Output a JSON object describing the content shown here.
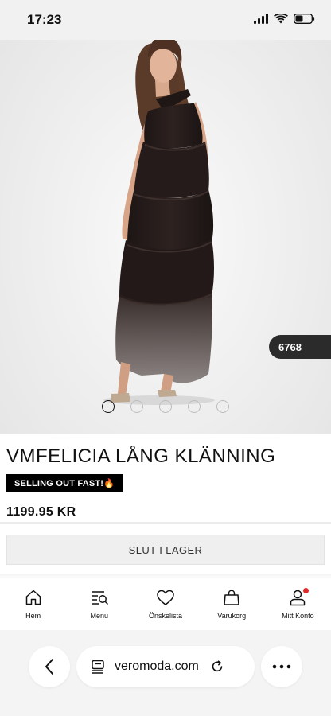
{
  "status_bar": {
    "time": "17:23"
  },
  "hero": {
    "image_counter": "6768",
    "carousel_pages": 5,
    "carousel_active_index": 0
  },
  "product": {
    "title": "VMFELICIA LÅNG KLÄNNING",
    "badge": "SELLING OUT FAST!🔥",
    "price": "1199.95 KR",
    "stock_button": "SLUT I LAGER"
  },
  "bottom_nav": {
    "items": [
      {
        "label": "Hem",
        "icon": "home-icon"
      },
      {
        "label": "Menu",
        "icon": "menu-search-icon"
      },
      {
        "label": "Önskelista",
        "icon": "heart-icon"
      },
      {
        "label": "Varukorg",
        "icon": "bag-icon"
      },
      {
        "label": "Mitt Konto",
        "icon": "account-icon"
      }
    ]
  },
  "browser": {
    "url": "veromoda.com"
  },
  "colors": {
    "badge_bg": "#000000",
    "counter_bg": "#2b2b2b",
    "notification": "#e32a2a",
    "button_bg": "#efefef"
  }
}
